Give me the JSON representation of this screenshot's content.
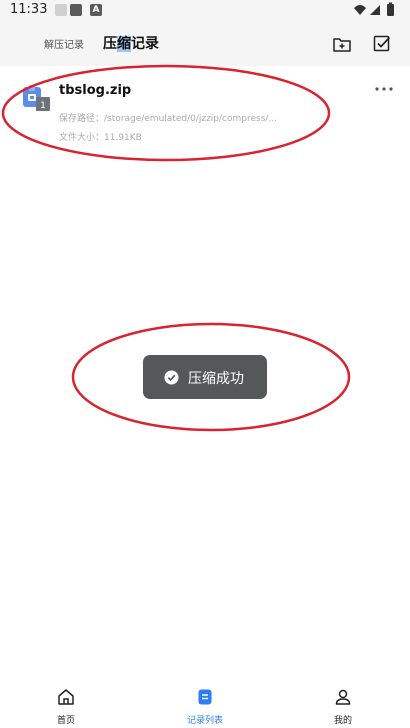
{
  "status_bar": {
    "time": "11:33",
    "app_badge": "A"
  },
  "header": {
    "tab_unzip": "解压记录",
    "tab_zip_pre": "压",
    "tab_zip_hl": "缩",
    "tab_zip_post": "记录",
    "icons": [
      "folder-add-icon",
      "checkbox-icon"
    ]
  },
  "record": {
    "file_name": "tbslog.zip",
    "file_badge": "1",
    "path_label": "保存路径：",
    "path_value": "/storage/emulated/0/jzzip/compress/...",
    "size_label": "文件大小：",
    "size_value": "11.91KB"
  },
  "toast": {
    "text": "压缩成功"
  },
  "bottom_nav": {
    "home": "首页",
    "records": "记录列表",
    "mine": "我的",
    "active": "records"
  },
  "colors": {
    "accent": "#2e7cf6",
    "annotation": "#d9232e",
    "toast_bg": "#555759",
    "header_bg": "#f5f5f5"
  }
}
